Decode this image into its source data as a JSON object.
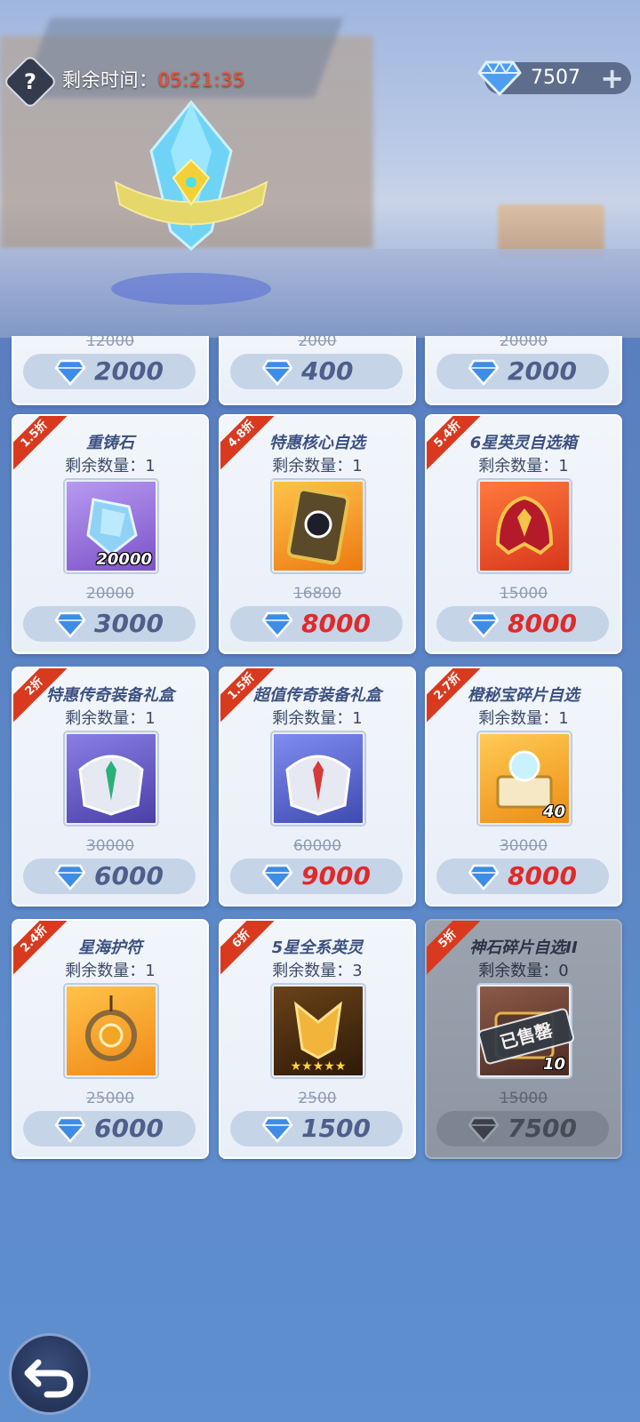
{
  "header": {
    "help_icon": "?",
    "timer_label": "剩余时间：",
    "timer_value": "05:21:35",
    "currency_amount": "7507",
    "plus_label": "+"
  },
  "top_row": [
    {
      "orig": "12000",
      "price": "2000"
    },
    {
      "orig": "2000",
      "price": "400"
    },
    {
      "orig": "20000",
      "price": "2000"
    }
  ],
  "items": [
    {
      "discount": "1.5折",
      "name": "重铸石",
      "remain": "剩余数量：1",
      "qty": "20000",
      "orig": "20000",
      "price": "3000",
      "price_color": "normal",
      "icon_color": "#8e6ad6"
    },
    {
      "discount": "4.8折",
      "name": "特惠核心自选",
      "remain": "剩余数量：1",
      "qty": "",
      "orig": "16800",
      "price": "8000",
      "price_color": "red",
      "icon_color": "#f08a18"
    },
    {
      "discount": "5.4折",
      "name": "6星英灵自选箱",
      "remain": "剩余数量：1",
      "qty": "",
      "orig": "15000",
      "price": "8000",
      "price_color": "red",
      "icon_color": "#e84424"
    },
    {
      "discount": "2折",
      "name": "特惠传奇装备礼盒",
      "remain": "剩余数量：1",
      "qty": "",
      "orig": "30000",
      "price": "6000",
      "price_color": "normal",
      "icon_color": "#6a5ec8"
    },
    {
      "discount": "1.5折",
      "name": "超值传奇装备礼盒",
      "remain": "剩余数量：1",
      "qty": "",
      "orig": "60000",
      "price": "9000",
      "price_color": "red",
      "icon_color": "#5a66cc"
    },
    {
      "discount": "2.7折",
      "name": "橙秘宝碎片自选",
      "remain": "剩余数量：1",
      "qty": "40",
      "orig": "30000",
      "price": "8000",
      "price_color": "red",
      "icon_color": "#f2a128"
    },
    {
      "discount": "2.4折",
      "name": "星海护符",
      "remain": "剩余数量：1",
      "qty": "",
      "orig": "25000",
      "price": "6000",
      "price_color": "normal",
      "icon_color": "#f59b1e"
    },
    {
      "discount": "6折",
      "name": "5星全系英灵",
      "remain": "剩余数量：3",
      "qty": "",
      "orig": "2500",
      "price": "1500",
      "price_color": "normal",
      "icon_color": "#4a2e12"
    },
    {
      "discount": "5折",
      "name": "神石碎片自选II",
      "remain": "剩余数量：0",
      "qty": "10",
      "orig": "15000",
      "price": "7500",
      "price_color": "normal",
      "icon_color": "#6e4a3a",
      "sold_out_label": "已售罄"
    }
  ]
}
